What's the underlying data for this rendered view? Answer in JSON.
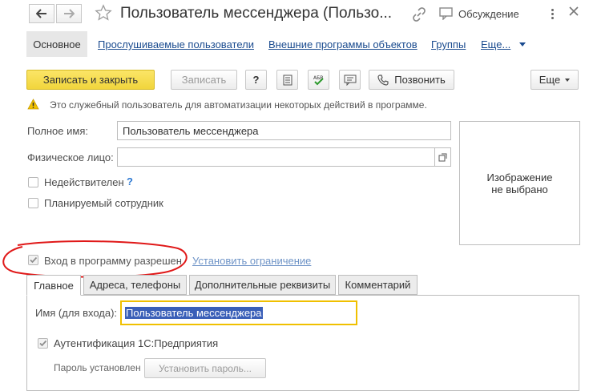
{
  "window": {
    "title": "Пользователь мессенджера (Пользо...",
    "discussion_label": "Обсуждение"
  },
  "nav_tabs": [
    {
      "label": "Основное",
      "active": true
    },
    {
      "label": "Прослушиваемые пользователи"
    },
    {
      "label": "Внешние программы объектов"
    },
    {
      "label": "Группы"
    },
    {
      "label": "Еще..."
    }
  ],
  "toolbar": {
    "save_close": "Записать и закрыть",
    "save": "Записать",
    "help": "?",
    "call": "Позвонить",
    "more": "Еще"
  },
  "notice": {
    "text": "Это служебный пользователь для автоматизации некоторых действий в программе."
  },
  "form": {
    "full_name_label": "Полное имя:",
    "full_name_value": "Пользователь мессенджера",
    "person_label": "Физическое лицо:",
    "person_value": "",
    "invalid_label": "Недействителен",
    "invalid_help": "?",
    "planned_label": "Планируемый сотрудник",
    "image_text_line1": "Изображение",
    "image_text_line2": "не выбрано",
    "login_allowed_label": "Вход в программу разрешен",
    "set_restriction_link": "Установить ограничение"
  },
  "inner_tabs": [
    {
      "label": "Главное",
      "active": true
    },
    {
      "label": "Адреса, телефоны"
    },
    {
      "label": "Дополнительные реквизиты"
    },
    {
      "label": "Комментарий"
    }
  ],
  "main_tab": {
    "login_name_label": "Имя (для входа):",
    "login_name_value": "Пользователь мессенджера",
    "auth_label": "Аутентификация 1С:Предприятия",
    "password_label": "Пароль установлен",
    "set_password_button": "Установить пароль..."
  },
  "colors": {
    "primary_button": "#f5dd4a",
    "link": "#1a4b8f",
    "selection": "#3a5fb8",
    "focus_border": "#f0c000",
    "annotation_circle": "#e01818"
  }
}
